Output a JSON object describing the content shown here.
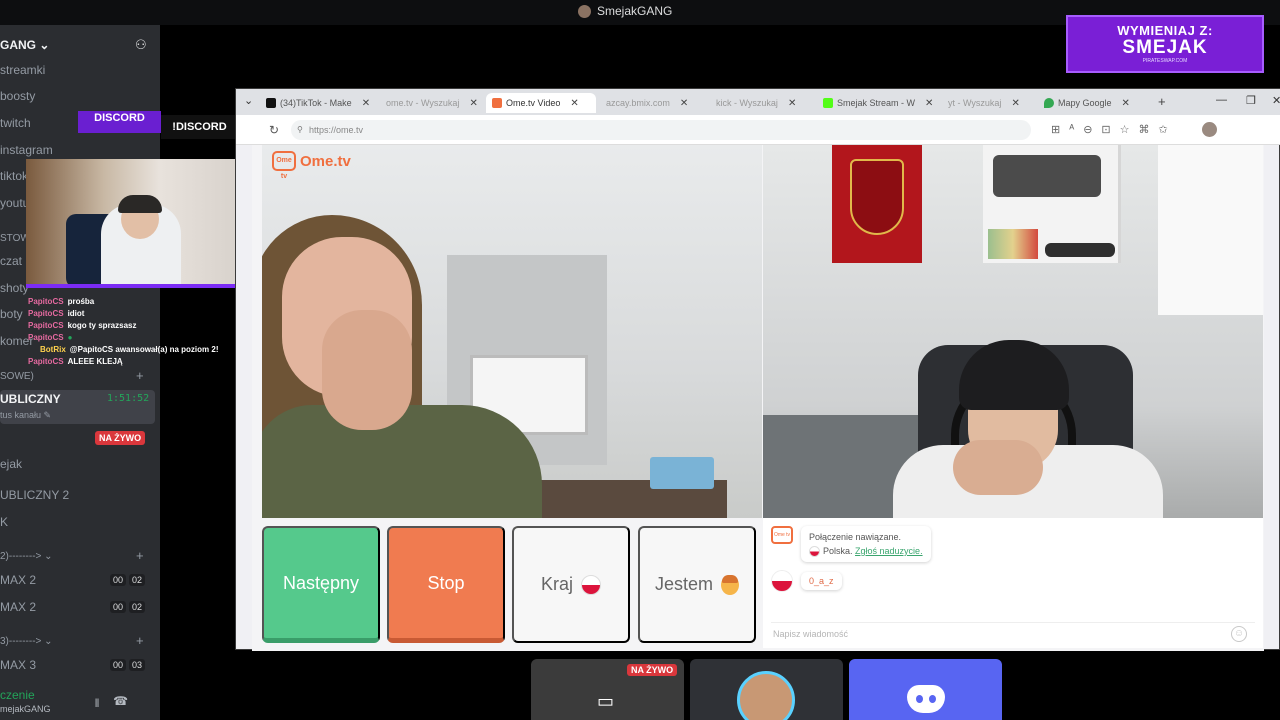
{
  "window": {
    "title": "SmejakGANG"
  },
  "sidebar": {
    "server_name": "GANG",
    "channels": [
      {
        "label": "streamki"
      },
      {
        "label": "boosty"
      },
      {
        "label": "twitch"
      },
      {
        "label": "instagram"
      },
      {
        "label": "tiktok"
      },
      {
        "label": "youtu"
      },
      {
        "label": "STOWE"
      },
      {
        "label": "czat"
      },
      {
        "label": "shoty"
      },
      {
        "label": "boty"
      },
      {
        "label": "komer"
      }
    ],
    "category_voice": "SOWE)",
    "active_voice": {
      "name": "UBLICZNY",
      "timer": "1:51:52",
      "sub": "tus kanału"
    },
    "live_label": "NA ŻYWO",
    "member": "ejak",
    "voice_channels": [
      {
        "label": "UBLICZNY 2"
      },
      {
        "label": "K"
      }
    ],
    "category2": "2)-------->",
    "max_rooms_a": [
      {
        "label": "MAX 2",
        "c1": "00",
        "c2": "02"
      },
      {
        "label": "MAX 2",
        "c1": "00",
        "c2": "02"
      }
    ],
    "category3": "3)-------->",
    "max_rooms_b": [
      {
        "label": "MAX 3",
        "c1": "00",
        "c2": "03"
      }
    ],
    "voice_status": "czenie",
    "voice_user": "mejakGANG"
  },
  "overlay": {
    "discord_banner": "DISCORD",
    "discord_cmd": "!DISCORD",
    "promo_line1": "WYMIENIAJ Z:",
    "promo_line2": "SMEJAK",
    "promo_line3": "PIRATESWAP.COM",
    "chat": [
      {
        "user": "PapitoCS",
        "msg": "prośba",
        "bot": false
      },
      {
        "user": "PapitoCS",
        "msg": "idiot",
        "bot": false
      },
      {
        "user": "PapitoCS",
        "msg": "kogo ty sprazsasz",
        "bot": false
      },
      {
        "user": "PapitoCS",
        "msg": "",
        "bot": false
      },
      {
        "user": "BotRix",
        "msg": "@PapitoCS awansował(a) na poziom 2!",
        "bot": true
      },
      {
        "user": "PapitoCS",
        "msg": "ALEEE KLEJĄ",
        "bot": false
      }
    ]
  },
  "browser": {
    "tabs": [
      {
        "label": "(34)TikTok - Make",
        "icon_color": "#111111",
        "active": false
      },
      {
        "label": "ome.tv - Wyszukaj",
        "icon_color": "#cccccc",
        "active": false
      },
      {
        "label": "Ome.tv Video",
        "icon_color": "#f06f3f",
        "active": true
      },
      {
        "label": "azcay.bmix.com",
        "icon_color": "#cccccc",
        "active": false
      },
      {
        "label": "kick - Wyszukaj",
        "icon_color": "#cccccc",
        "active": false
      },
      {
        "label": "Smejak Stream - W",
        "icon_color": "#53fc18",
        "active": false
      },
      {
        "label": "yt - Wyszukaj",
        "icon_color": "#cccccc",
        "active": false
      },
      {
        "label": "Mapy Google",
        "icon_color": "#34a853",
        "active": false
      }
    ],
    "url": "https://ome.tv"
  },
  "ometv": {
    "logo": "Ome.tv",
    "logo_small": "Ome tv",
    "buttons": {
      "next": "Następny",
      "stop": "Stop",
      "country": "Kraj",
      "gender": "Jestem"
    },
    "system_message": {
      "line1": "Połączenie nawiązane.",
      "country": "Polska.",
      "report": "Zgłoś naduzycie."
    },
    "peer_message": "0_a_z",
    "input_placeholder": "Napisz wiadomość"
  },
  "bottom_tiles": {
    "live_label": "NA ŻYWO"
  },
  "colors": {
    "next": "#55c98c",
    "stop": "#f07b50",
    "accent_purple": "#7a1fd6",
    "live_red": "#da373c",
    "discord_blurple": "#5865f2"
  }
}
